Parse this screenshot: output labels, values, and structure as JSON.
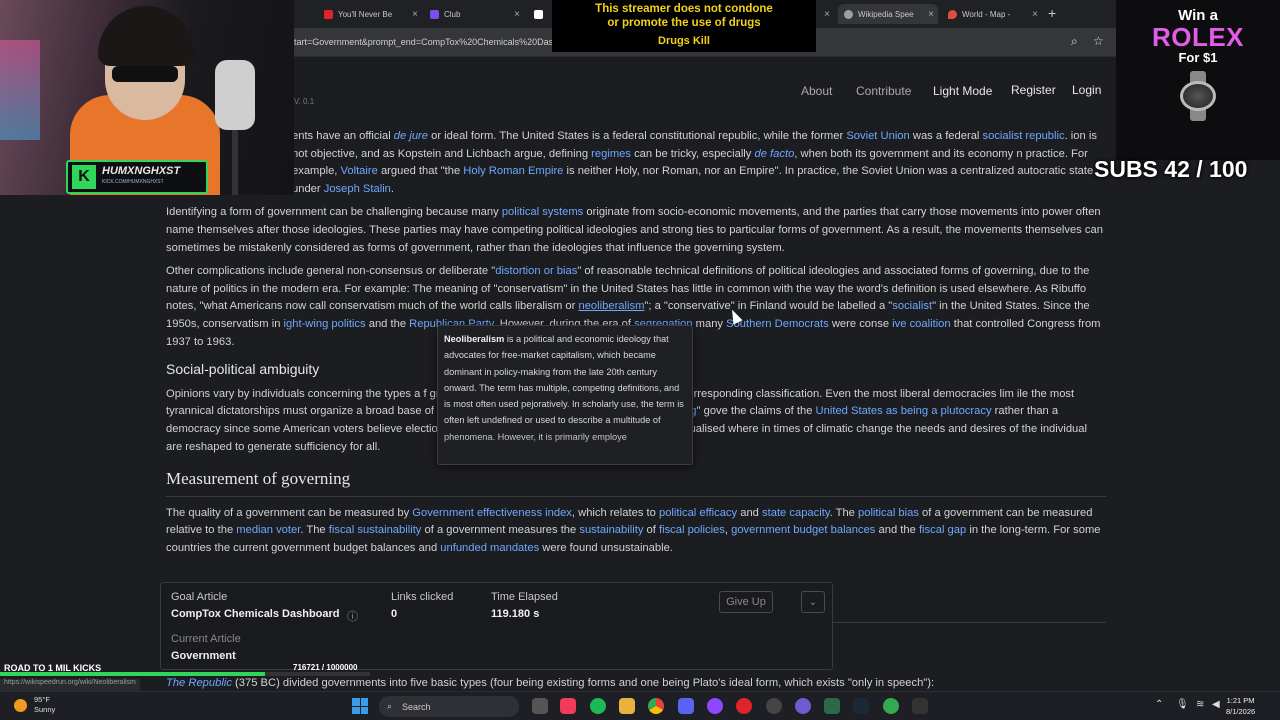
{
  "browser": {
    "tabs": [
      {
        "label": "You'll Never Be",
        "color": "#e0242b"
      },
      {
        "label": "Club",
        "color": "#7b4dea"
      },
      {
        "label": "X",
        "color": "#ffffff"
      },
      {
        "label": "Wikipedia Spee",
        "color": "#9aa0a6"
      },
      {
        "label": "World - Map -",
        "color": "#e14d3b"
      }
    ],
    "url": "tart=Government&prompt_end=CompTox%20Chemicals%20Dashboard&lang",
    "new_tab": "+"
  },
  "site": {
    "version": "V. 0.1",
    "nav": {
      "about": "About",
      "contribute": "Contribute",
      "light_mode": "Light Mode",
      "register": "Register",
      "login": "Login"
    }
  },
  "article": {
    "p1": {
      "t1": "ents have an official ",
      "l1": "de jure",
      "t2": " or ideal form. The United States is a federal constitutional republic, while the former ",
      "l2": "Soviet Union",
      "t3": " was a federal ",
      "l3": "socialist republic",
      "t4": ". ion is not objective, and as Kopstein and Lichbach argue, defining ",
      "l4": "regimes",
      "t5": " can be tricky, especially ",
      "l5": "de facto",
      "t6": ", when both its government and its economy n practice. For example, ",
      "l6": "Voltaire",
      "t7": " argued that \"the ",
      "l7": "Holy Roman Empire",
      "t8": " is neither Holy, nor Roman, nor an Empire\". In practice, the Soviet Union was a centralized autocratic state under ",
      "l8": "Joseph Stalin",
      "t9": "."
    },
    "p2": {
      "t1": "Identifying a form of government can be challenging because many ",
      "l1": "political systems",
      "t2": " originate from socio-economic movements, and the parties that carry those movements into power often name themselves after those ideologies. These parties may have competing political ideologies and strong ties to particular forms of government. As a result, the movements themselves can sometimes be mistakenly considered as forms of government, rather than the ideologies that influence the governing system."
    },
    "p3": {
      "t1": "Other complications include general non-consensus or deliberate \"",
      "l1": "distortion or bias",
      "t2": "\" of reasonable technical definitions of political ideologies and associated forms of governing, due to the nature of politics in the modern era. For example: The meaning of \"conservatism\" in the United States has little in common with the way the word's definition is used elsewhere. As Ribuffo notes, \"what Americans now call conservatism much of the world calls liberalism or ",
      "l2": "neoliberalism",
      "t3": "\"; a \"conservative\" in Finland would be labelled a \"",
      "l3": "socialist",
      "t4": "\" in the United States. Since the 1950s, conservatism in ",
      "l4": "ight-wing politics",
      "t5": " and the ",
      "l5": "Republican Party",
      "t6": ". However, during the era of ",
      "l6": "segregation",
      "t7": " many ",
      "l7": "Southern Democrats",
      "t8": " were conse ",
      "l8": "ive coalition",
      "t9": " that controlled Congress from 1937 to 1963."
    },
    "h_ambiguity": "Social-political ambiguity",
    "p4": {
      "t1": "Opinions vary by individuals concerning the types a f gray\" are commonplace in any government and its corresponding classification. Even the most liberal democracies lim ile the most tyrannical dictatorships must organize a broad base of support thereby creating difficulties for \"",
      "l1": "pigeonholing",
      "t2": "\" gove the claims of the ",
      "l2": "United States as being a plutocracy",
      "t3": " rather than a democracy since some American voters believe elections are be isider that government is to be reconceptualised where in times of climatic change the needs and desires of the individual are reshaped to generate sufficiency for all."
    },
    "h_measurement": "Measurement of governing",
    "p5": {
      "t1": "The quality of a government can be measured by ",
      "l1": "Government effectiveness index",
      "t2": ", which relates to ",
      "l2": "political efficacy",
      "t3": " and ",
      "l3": "state capacity",
      "t4": ". The ",
      "l4": "political bias",
      "t5": " of a government can be measured relative to the ",
      "l5": "median voter",
      "t6": ". The ",
      "l6": "fiscal sustainability",
      "t7": " of a government measures the ",
      "l7": "sustainability",
      "t8": " of ",
      "l8": "fiscal policies",
      "t9": ", ",
      "l9": "government budget balances",
      "t10": " and the ",
      "l10": "fiscal gap",
      "t11": " in the long-term. For some countries the current government budget balances and ",
      "l11": "unfunded mandates",
      "t12": " were found unsustainable."
    },
    "last": {
      "l1": "The Republic",
      "t1": " (375 BC) divided governments into five basic types (four being existing forms and one being Plato's ideal form, which exists \"only in speech\"):"
    }
  },
  "tooltip": {
    "term": "Neoliberalism",
    "text": " is a political and economic ideology that advocates for free-market capitalism, which became dominant in policy-making from the late 20th century onward. The term has multiple, competing definitions, and is most often used pejoratively. In scholarly use, the term is often left undefined or used to describe a multitude of phenomena. However, it is primarily employe"
  },
  "game": {
    "goal_label": "Goal Article",
    "goal_value": "CompTox Chemicals Dashboard",
    "goal_info": "ⓘ",
    "current_label": "Current Article",
    "current_value": "Government",
    "clicks_label": "Links clicked",
    "clicks_value": "0",
    "time_label": "Time Elapsed",
    "time_value": "119.180 s",
    "give_up": "Give Up",
    "collapse": "⌄"
  },
  "status_url": "https://wikispeedrun.org/wiki/Neoliberalism",
  "overlay": {
    "disclaimer_line1": "This streamer does not condone",
    "disclaimer_line2": "or promote the use of drugs",
    "disclaimer_line3": "Drugs Kill",
    "ad_win": "Win a",
    "ad_brand": "ROLEX",
    "ad_price": "For $1",
    "subs": "SUBS 42 / 100",
    "kicks_label": "ROAD TO 1 MIL KICKS",
    "kicks_count": "716721 / 1000000",
    "kicks_progress": 0.7167,
    "streamer_name": "HUMXNGHXST",
    "streamer_sub": "KICK.COM/HUMXNGHXST",
    "kick_letter": "K"
  },
  "taskbar": {
    "temp": "95°F",
    "weather": "Sunny",
    "search": "Search",
    "time": "1:21 PM",
    "date": "8/1/2026"
  }
}
